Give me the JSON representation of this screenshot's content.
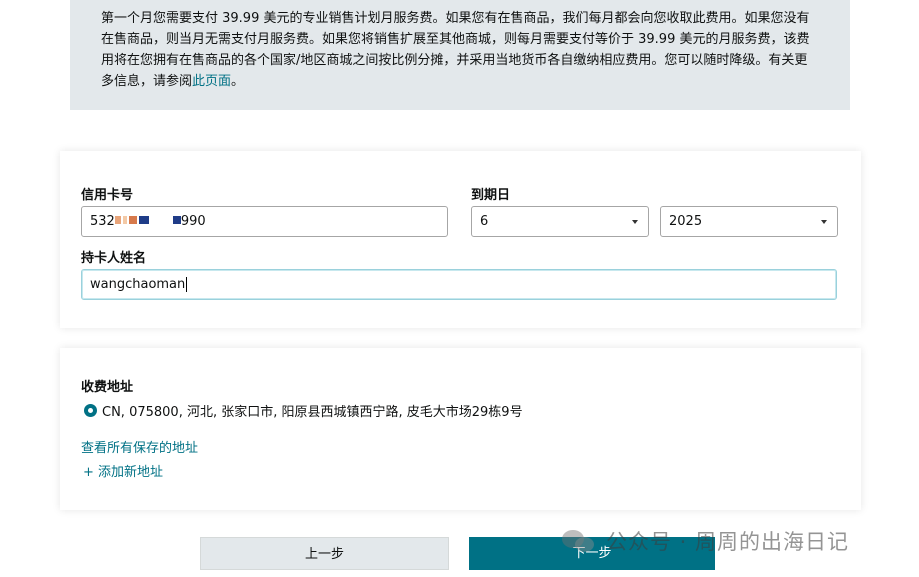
{
  "notice": {
    "text": "第一个月您需要支付 39.99 美元的专业销售计划月服务费。如果您有在售商品，我们每月都会向您收取此费用。如果您没有在售商品，则当月无需支付月服务费。如果您将销售扩展至其他商城，则每月需要支付等价于 39.99 美元的月服务费，该费用将在您拥有在售商品的各个国家/地区商城之间按比例分摊，并采用当地货币各自缴纳相应费用。您可以随时降级。有关更多信息，请参阅",
    "link": "此页面",
    "end": "。"
  },
  "payment": {
    "card_number_label": "信用卡号",
    "card_number_prefix": "532",
    "card_number_suffix": "990",
    "expiry_label": "到期日",
    "expiry_month": "6",
    "expiry_year": "2025",
    "holder_label": "持卡人姓名",
    "holder_value": "wangchaoman"
  },
  "address": {
    "label": "收费地址",
    "selected": "CN, 075800, 河北, 张家口市, 阳原县西城镇西宁路, 皮毛大市场29栋9号",
    "view_all": "查看所有保存的地址",
    "add_new": "+ 添加新地址"
  },
  "buttons": {
    "prev": "上一步",
    "next": "下一步"
  },
  "watermark": {
    "text": "公众号 · 周周的出海日记"
  },
  "colors": {
    "accent": "#007185",
    "notice_bg": "#e3e8eb"
  }
}
